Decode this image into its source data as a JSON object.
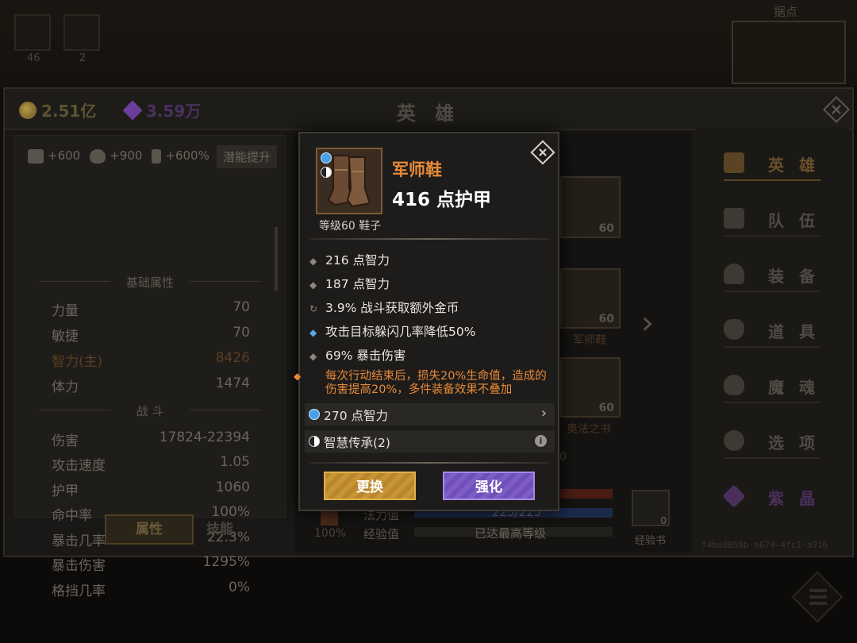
{
  "top": {
    "slot_counts": [
      "46",
      "2"
    ],
    "map_label": "据点"
  },
  "header": {
    "gold": "2.51亿",
    "gems": "3.59万",
    "title": "英 雄"
  },
  "left": {
    "buffs": [
      "+600",
      "+900",
      "+600%"
    ],
    "potential_button": "潜能提升",
    "section_basic": "基础属性",
    "basic_stats": [
      {
        "label": "力量",
        "value": "70"
      },
      {
        "label": "敏捷",
        "value": "70"
      },
      {
        "label": "智力(主)",
        "value": "8426"
      },
      {
        "label": "体力",
        "value": "1474"
      }
    ],
    "section_combat": "战 斗",
    "combat_stats": [
      {
        "label": "伤害",
        "value": "17824-22394"
      },
      {
        "label": "攻击速度",
        "value": "1.05"
      },
      {
        "label": "护甲",
        "value": "1060"
      },
      {
        "label": "命中率",
        "value": "100%"
      },
      {
        "label": "暴击几率",
        "value": "22.3%"
      },
      {
        "label": "暴击伤害",
        "value": "1295%"
      },
      {
        "label": "格挡几率",
        "value": "0%"
      }
    ],
    "tab_attributes": "属性",
    "tab_skills": "技能"
  },
  "center": {
    "card_levels": [
      "60",
      "60",
      "60"
    ],
    "card_boots_label": "军师鞋",
    "card_book_label": "奥法之书",
    "left_percent": "100%",
    "mana_label": "法力值",
    "mana_value": "225/225",
    "exp_label": "经验值",
    "exp_value": "已达最高等级",
    "exp_book_count": "0",
    "exp_book_label": "经验书",
    "partial_level": "60"
  },
  "nav": {
    "items": [
      "英 雄",
      "队 伍",
      "装 备",
      "道 具",
      "魔 魂",
      "选 项",
      "紫 晶"
    ]
  },
  "id_text": "f4ba0850b-e674-4fc1-a916",
  "item_popup": {
    "name": "军师鞋",
    "armor": "416 点护甲",
    "level_type": "等级60 鞋子",
    "attributes": [
      {
        "bullet": "◆",
        "text": "216 点智力"
      },
      {
        "bullet": "◆",
        "text": "187 点智力"
      },
      {
        "bullet": "↻",
        "text": "3.9% 战斗获取额外金币"
      },
      {
        "bullet": "◆",
        "text": "攻击目标躲闪几率降低50%"
      },
      {
        "bullet": "◆",
        "text": "69% 暴击伤害"
      }
    ],
    "special": "每次行动结束后，损失20%生命值，造成的伤害提高20%，多件装备效果不叠加",
    "special_bullet": "◆",
    "gem_text": "270 点智力",
    "gem_arrow": "›",
    "set_text": "智慧传承(2)",
    "info_glyph": "i",
    "btn_replace": "更换",
    "btn_upgrade": "强化",
    "close_glyph": "×"
  },
  "colors": {
    "item_name": "#e6893a",
    "special": "#e6893a",
    "replace_button": "#c99534",
    "upgrade_button": "#7e5ec6"
  }
}
